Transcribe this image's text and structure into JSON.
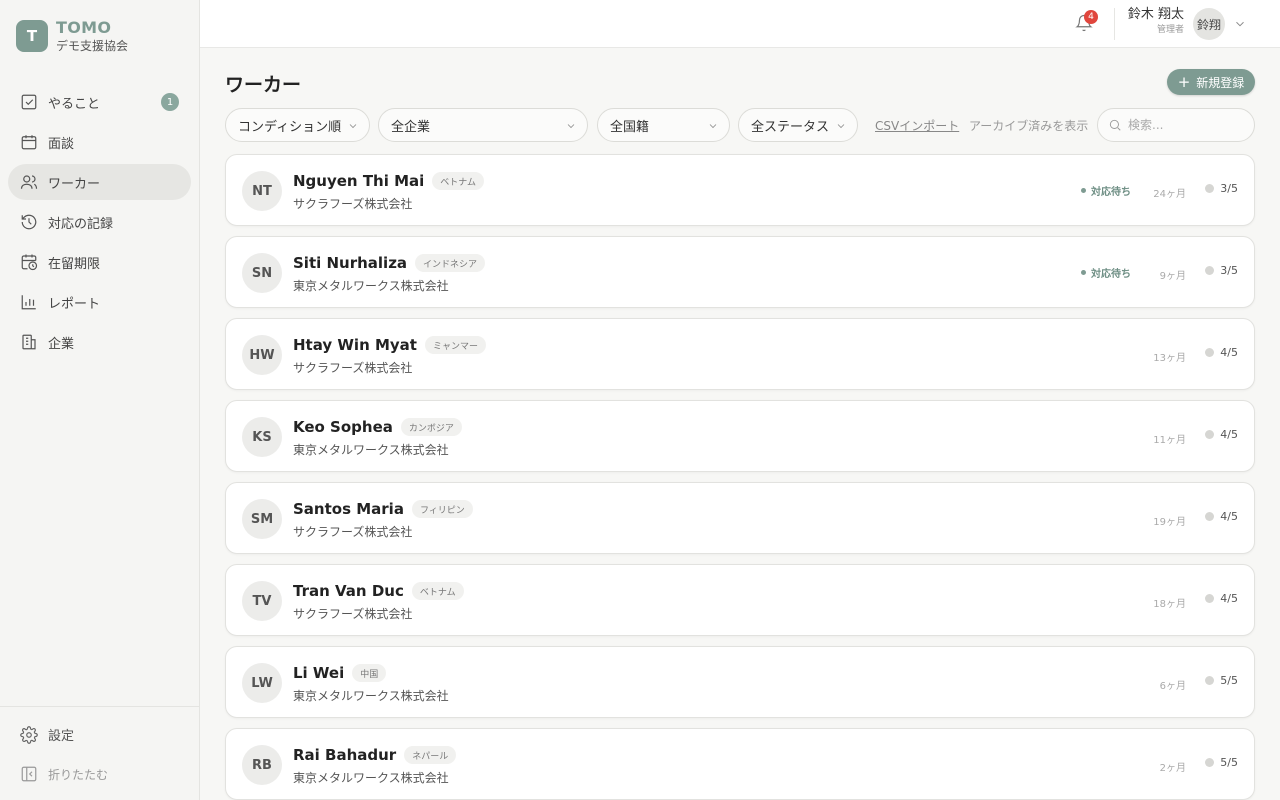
{
  "brand": {
    "logo_letter": "T",
    "name": "TOMO",
    "org": "デモ支援協会"
  },
  "nav": [
    {
      "label": "やること",
      "icon": "checkbox-icon",
      "badge": "1",
      "active": false
    },
    {
      "label": "面談",
      "icon": "calendar-icon",
      "active": false
    },
    {
      "label": "ワーカー",
      "icon": "users-icon",
      "active": true
    },
    {
      "label": "対応の記録",
      "icon": "history-icon",
      "active": false
    },
    {
      "label": "在留期限",
      "icon": "calendar-clock-icon",
      "active": false
    },
    {
      "label": "レポート",
      "icon": "bar-chart-icon",
      "active": false
    },
    {
      "label": "企業",
      "icon": "building-icon",
      "active": false
    }
  ],
  "sidebar_bottom": {
    "settings": "設定",
    "collapse": "折りたたむ"
  },
  "header": {
    "notifications": "4",
    "user_name": "鈴木 翔太",
    "user_role": "管理者",
    "avatar": "鈴翔"
  },
  "main": {
    "title": "ワーカー",
    "new_button": "新規登録",
    "filters": {
      "sort": "コンディション順",
      "company": "全企業",
      "nationality": "全国籍",
      "status": "全ステータス"
    },
    "csv_import": "CSVインポート",
    "show_archived": "アーカイブ済みを表示",
    "search_placeholder": "検索..."
  },
  "workers": [
    {
      "initials": "NT",
      "name": "Nguyen Thi Mai",
      "nationality": "ベトナム",
      "company": "サクラフーズ株式会社",
      "status": "対応待ち",
      "tenure": "24ヶ月",
      "score": "3/5"
    },
    {
      "initials": "SN",
      "name": "Siti Nurhaliza",
      "nationality": "インドネシア",
      "company": "東京メタルワークス株式会社",
      "status": "対応待ち",
      "tenure": "9ヶ月",
      "score": "3/5"
    },
    {
      "initials": "HW",
      "name": "Htay Win Myat",
      "nationality": "ミャンマー",
      "company": "サクラフーズ株式会社",
      "status": "",
      "tenure": "13ヶ月",
      "score": "4/5"
    },
    {
      "initials": "KS",
      "name": "Keo Sophea",
      "nationality": "カンボジア",
      "company": "東京メタルワークス株式会社",
      "status": "",
      "tenure": "11ヶ月",
      "score": "4/5"
    },
    {
      "initials": "SM",
      "name": "Santos Maria",
      "nationality": "フィリピン",
      "company": "サクラフーズ株式会社",
      "status": "",
      "tenure": "19ヶ月",
      "score": "4/5"
    },
    {
      "initials": "TV",
      "name": "Tran Van Duc",
      "nationality": "ベトナム",
      "company": "サクラフーズ株式会社",
      "status": "",
      "tenure": "18ヶ月",
      "score": "4/5"
    },
    {
      "initials": "LW",
      "name": "Li Wei",
      "nationality": "中国",
      "company": "東京メタルワークス株式会社",
      "status": "",
      "tenure": "6ヶ月",
      "score": "5/5"
    },
    {
      "initials": "RB",
      "name": "Rai Bahadur",
      "nationality": "ネパール",
      "company": "東京メタルワークス株式会社",
      "status": "",
      "tenure": "2ヶ月",
      "score": "5/5"
    }
  ],
  "colors": {
    "accent": "#7e9b92",
    "notification": "#e0463d",
    "status_text": "#6f8f85"
  }
}
